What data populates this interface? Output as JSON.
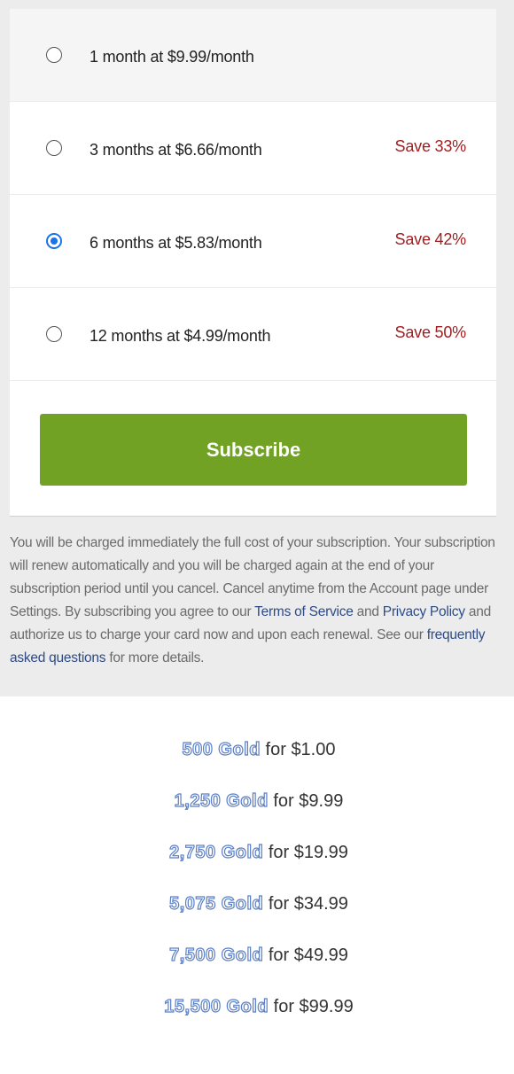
{
  "plans": [
    {
      "label": "1 month at $9.99/month",
      "save": "",
      "selected": false
    },
    {
      "label": "3 months at $6.66/month",
      "save": "Save 33%",
      "selected": false
    },
    {
      "label": "6 months at $5.83/month",
      "save": "Save 42%",
      "selected": true
    },
    {
      "label": "12 months at $4.99/month",
      "save": "Save 50%",
      "selected": false
    }
  ],
  "subscribe_label": "Subscribe",
  "disclaimer": {
    "text_1": "You will be charged immediately the full cost of your subscription. Your subscription will renew automatically and you will be charged again at the end of your subscription period until you cancel. Cancel anytime from the Account page under Settings. By subscribing you agree to our ",
    "terms_link": "Terms of Service",
    "text_2": " and ",
    "privacy_link": "Privacy Policy",
    "text_3": " and authorize us to charge your card now and upon each renewal. See our ",
    "faq_link": "frequently asked questions",
    "text_4": " for more details."
  },
  "gold_offers": [
    {
      "amount": "500 Gold",
      "price": " for $1.00"
    },
    {
      "amount": "1,250 Gold",
      "price": " for $9.99"
    },
    {
      "amount": "2,750 Gold",
      "price": " for $19.99"
    },
    {
      "amount": "5,075 Gold",
      "price": " for $34.99"
    },
    {
      "amount": "7,500 Gold",
      "price": " for $49.99"
    },
    {
      "amount": "15,500 Gold",
      "price": " for $99.99"
    }
  ],
  "colors": {
    "accent_button": "#72a223",
    "save_text": "#a01e22",
    "radio_selected": "#1a73e8",
    "link": "#2e4b86"
  }
}
